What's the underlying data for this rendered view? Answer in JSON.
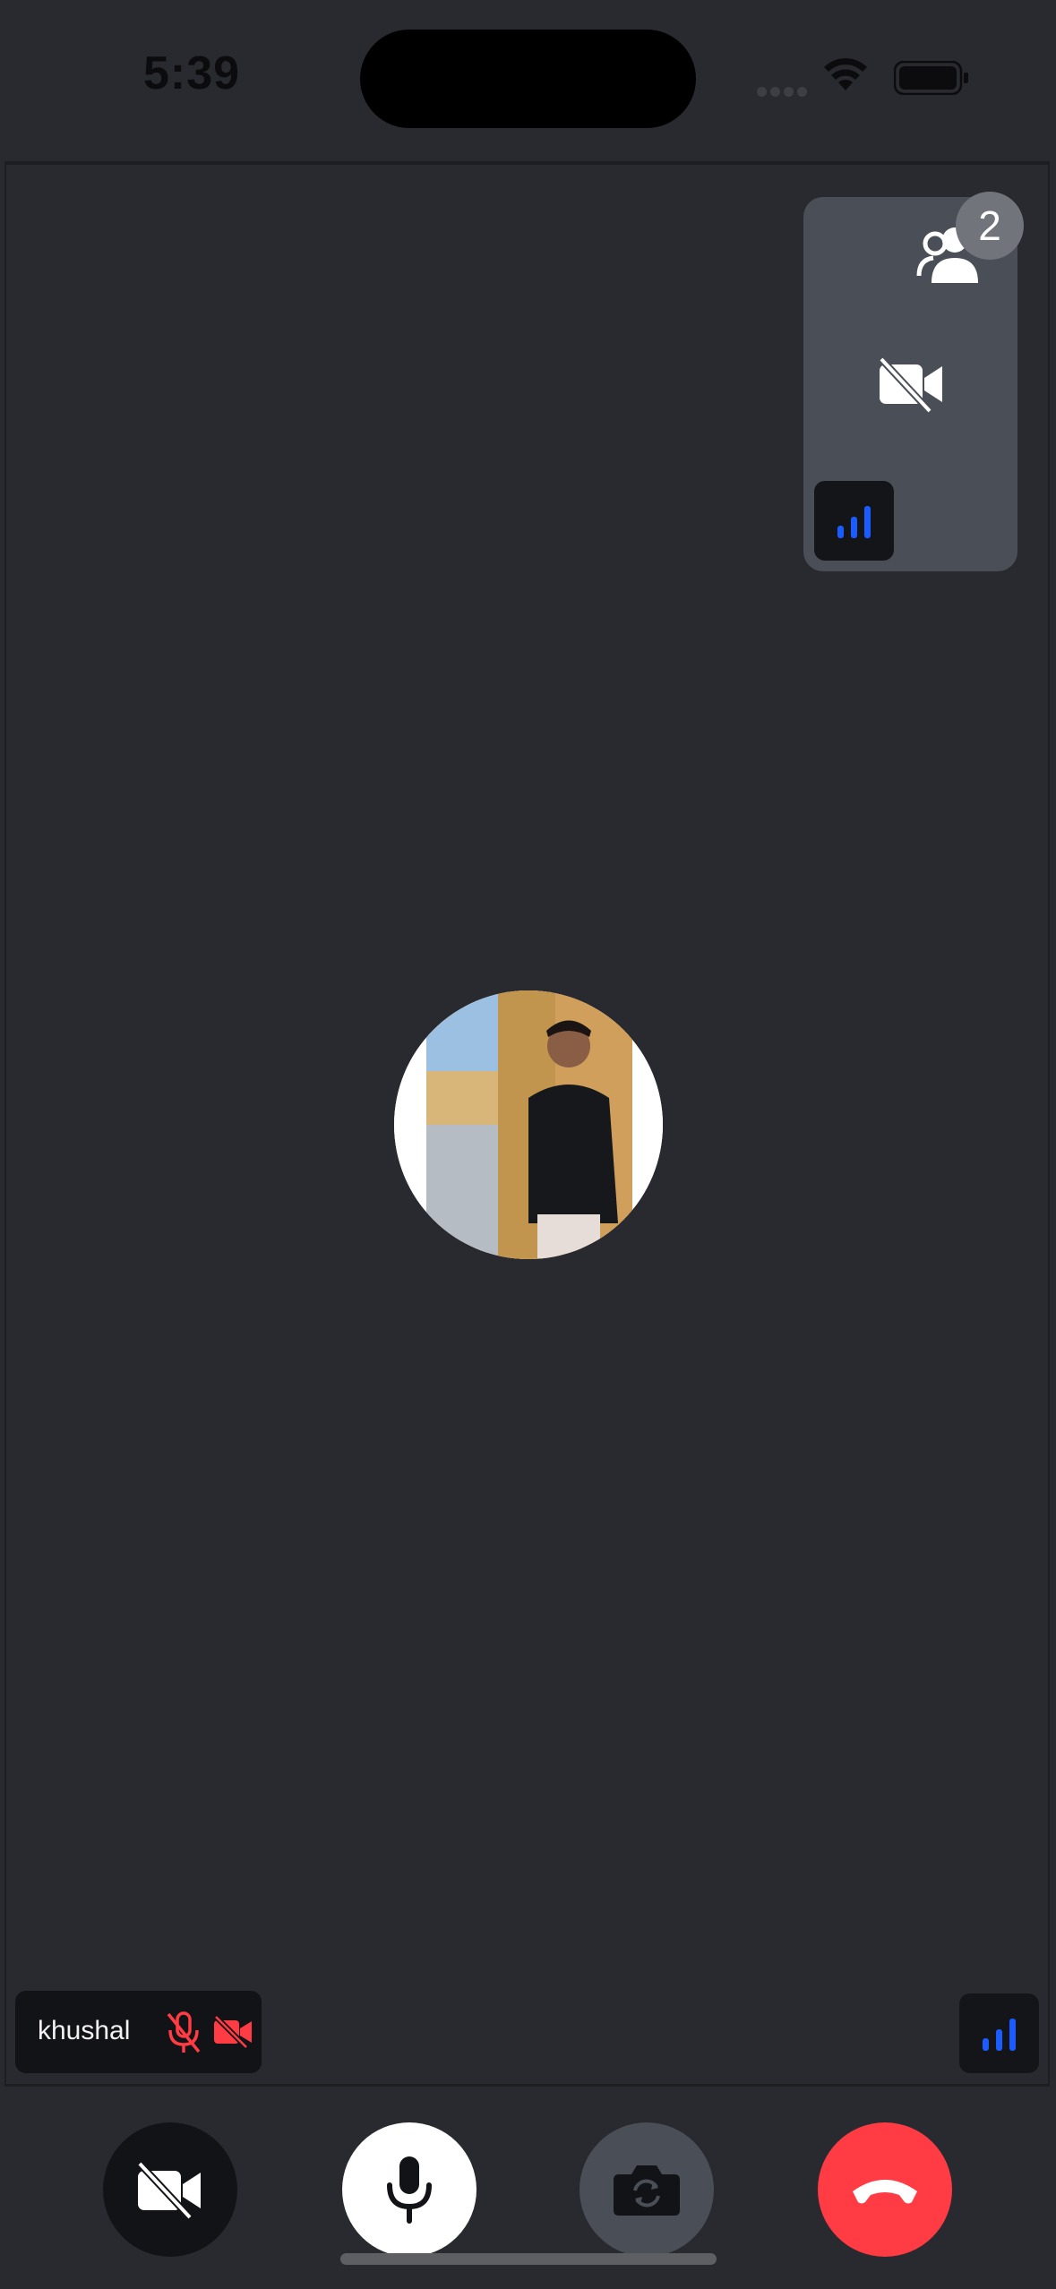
{
  "status_bar": {
    "time": "5:39"
  },
  "pip": {
    "participant_count": "2",
    "icons": [
      "people-icon",
      "video-off-icon",
      "network-signal-icon"
    ]
  },
  "main": {
    "participant_name": "khushal",
    "icons": [
      "mic-off-icon",
      "camera-off-icon",
      "network-signal-icon"
    ]
  },
  "controls": {
    "buttons": [
      "toggle-video-button",
      "toggle-mic-button",
      "switch-camera-button",
      "end-call-button"
    ]
  },
  "colors": {
    "background": "#282a30",
    "pip_tile": "#4a4e57",
    "signal_blue": "#1a5cff",
    "muted_red": "#ff3b44",
    "end_call_red": "#ff3b44"
  }
}
